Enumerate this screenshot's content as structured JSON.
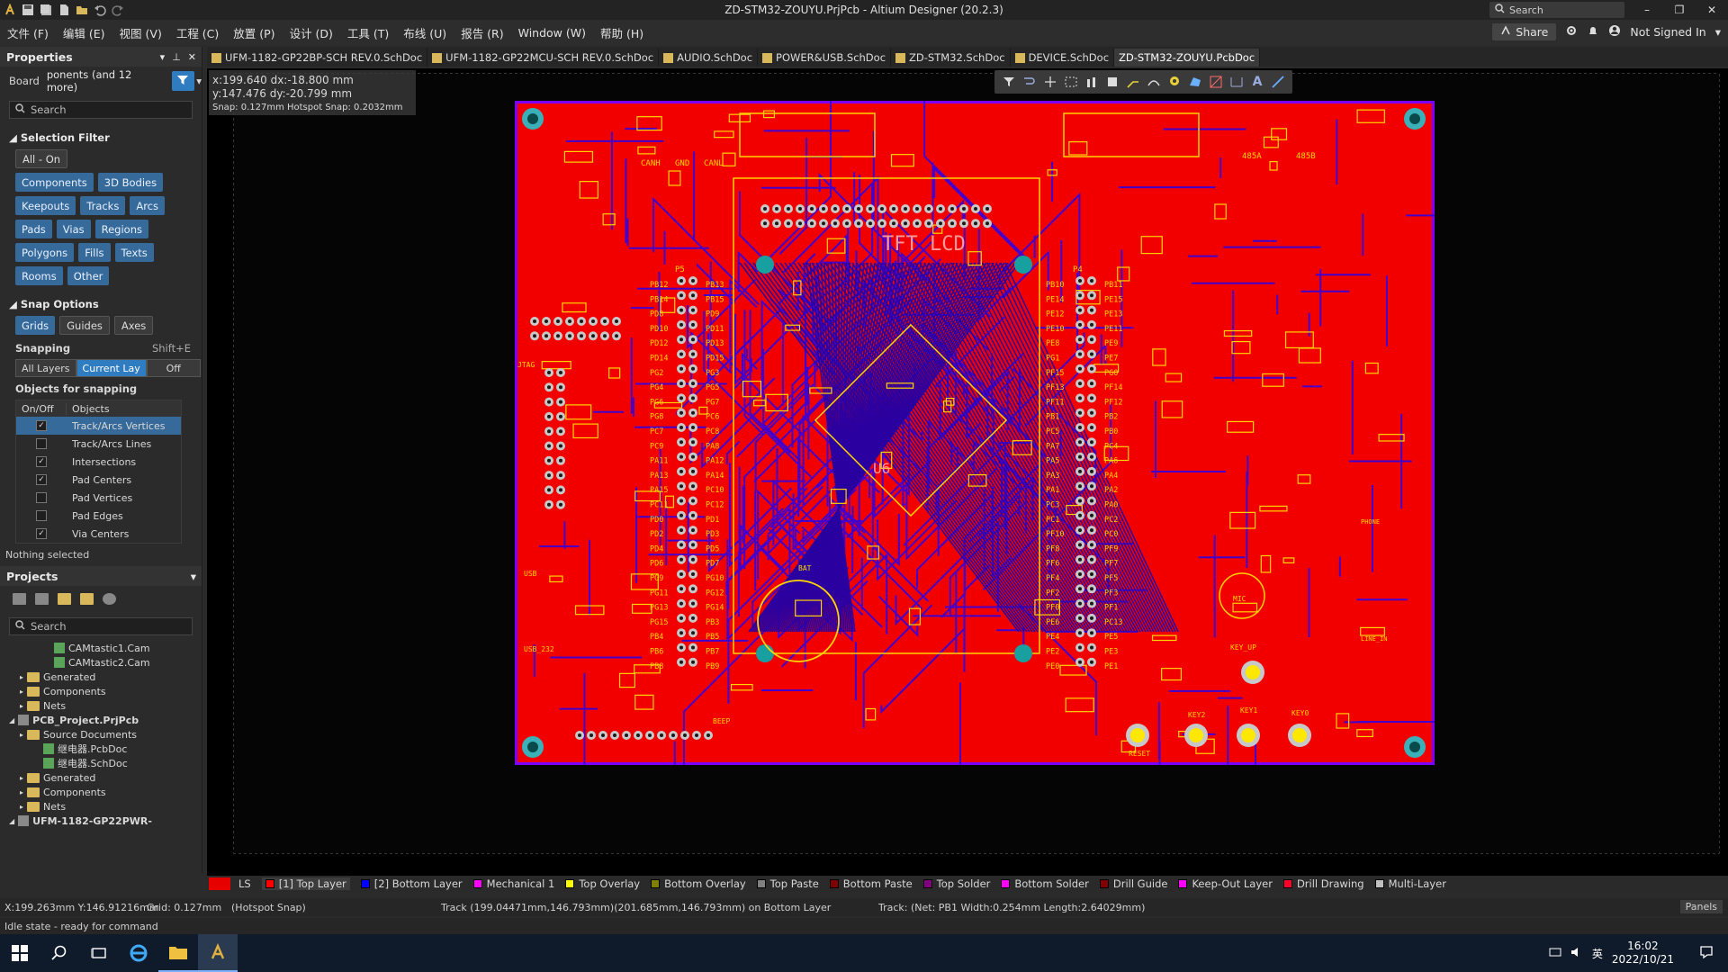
{
  "window": {
    "title": "ZD-STM32-ZOUYU.PrjPcb - Altium Designer (20.2.3)",
    "search_label": "Search",
    "controls": [
      "–",
      "❐",
      "✕"
    ]
  },
  "menu": {
    "items": [
      "文件 (F)",
      "编辑 (E)",
      "视图 (V)",
      "工程 (C)",
      "放置 (P)",
      "设计 (D)",
      "工具 (T)",
      "布线 (U)",
      "报告 (R)",
      "Window (W)",
      "帮助 (H)"
    ],
    "share_label": "Share",
    "user_label": "Not Signed In"
  },
  "properties": {
    "title": "Properties",
    "board_label": "Board",
    "board_value": "ponents (and 12 more)",
    "search_placeholder": "Search",
    "selection_filter_title": "Selection Filter",
    "all_on": "All - On",
    "filter_buttons": [
      "Components",
      "3D Bodies",
      "Keepouts",
      "Tracks",
      "Arcs",
      "Pads",
      "Vias",
      "Regions",
      "Polygons",
      "Fills",
      "Texts",
      "Rooms",
      "Other"
    ],
    "snap_options_title": "Snap Options",
    "snap_buttons": [
      "Grids",
      "Guides",
      "Axes"
    ],
    "snapping_label": "Snapping",
    "snapping_shortcut": "Shift+E",
    "snap_modes": [
      "All Layers",
      "Current Lay",
      "Off"
    ],
    "objects_title": "Objects for snapping",
    "table_headers": [
      "On/Off",
      "Objects"
    ],
    "objects": [
      {
        "name": "Track/Arcs Vertices",
        "checked": true,
        "selected": true
      },
      {
        "name": "Track/Arcs Lines",
        "checked": false,
        "selected": false
      },
      {
        "name": "Intersections",
        "checked": true,
        "selected": false
      },
      {
        "name": "Pad Centers",
        "checked": true,
        "selected": false
      },
      {
        "name": "Pad Vertices",
        "checked": false,
        "selected": false
      },
      {
        "name": "Pad Edges",
        "checked": false,
        "selected": false
      },
      {
        "name": "Via Centers",
        "checked": true,
        "selected": false
      }
    ],
    "nothing_selected": "Nothing selected"
  },
  "projects": {
    "title": "Projects",
    "search_placeholder": "Search",
    "tree": [
      {
        "label": "CAMtastic1.Cam",
        "indent": 3,
        "type": "file"
      },
      {
        "label": "CAMtastic2.Cam",
        "indent": 3,
        "type": "file"
      },
      {
        "label": "Generated",
        "indent": 1,
        "type": "folder"
      },
      {
        "label": "Components",
        "indent": 1,
        "type": "folder"
      },
      {
        "label": "Nets",
        "indent": 1,
        "type": "folder"
      },
      {
        "label": "PCB_Project.PrjPcb",
        "indent": 0,
        "type": "project"
      },
      {
        "label": "Source Documents",
        "indent": 1,
        "type": "folder"
      },
      {
        "label": "继电器.PcbDoc",
        "indent": 2,
        "type": "file"
      },
      {
        "label": "继电器.SchDoc",
        "indent": 2,
        "type": "file"
      },
      {
        "label": "Generated",
        "indent": 1,
        "type": "folder"
      },
      {
        "label": "Components",
        "indent": 1,
        "type": "folder"
      },
      {
        "label": "Nets",
        "indent": 1,
        "type": "folder"
      },
      {
        "label": "UFM-1182-GP22PWR-",
        "indent": 0,
        "type": "project"
      }
    ]
  },
  "doc_tabs": [
    {
      "label": "UFM-1182-GP22BP-SCH REV.0.SchDoc",
      "active": false,
      "kind": "sch"
    },
    {
      "label": "UFM-1182-GP22MCU-SCH REV.0.SchDoc",
      "active": false,
      "kind": "sch"
    },
    {
      "label": "AUDIO.SchDoc",
      "active": false,
      "kind": "sch"
    },
    {
      "label": "POWER&USB.SchDoc",
      "active": false,
      "kind": "sch"
    },
    {
      "label": "ZD-STM32.SchDoc",
      "active": false,
      "kind": "sch"
    },
    {
      "label": "DEVICE.SchDoc",
      "active": false,
      "kind": "sch"
    },
    {
      "label": "ZD-STM32-ZOUYU.PcbDoc",
      "active": true,
      "kind": "pcb"
    }
  ],
  "hud": {
    "line1": "x:199.640   dx:-18.800 mm",
    "line2": "y:147.476   dy:-20.799 mm",
    "line3": "Snap: 0.127mm Hotspot Snap: 0.2032mm"
  },
  "pcb_labels": {
    "tft": "TFT LCD",
    "u6": "U6",
    "p5": "P5",
    "p4": "P4",
    "jtag": "JTAG",
    "usb": "USB",
    "bat": "BAT",
    "mic": "MIC",
    "reset": "RESET",
    "key_up": "KEY_UP",
    "key2": "KEY2",
    "key1": "KEY1",
    "key0": "KEY0",
    "beep": "BEEP",
    "canh": "CANH",
    "gnd": "GND",
    "canl": "CANL",
    "r485a": "485A",
    "r485b": "485B",
    "usb232": "USB_232",
    "phone": "PHONE",
    "line_in": "LINE_IN",
    "left_pins": [
      "PB12",
      "PB14",
      "PD8",
      "PD10",
      "PD12",
      "PD14",
      "PG2",
      "PG4",
      "PG6",
      "PG8",
      "PC7",
      "PC9",
      "PA11",
      "PA13",
      "PA15",
      "PC11",
      "PD0",
      "PD2",
      "PD4",
      "PD6",
      "PG9",
      "PG11",
      "PG13",
      "PG15",
      "PB4",
      "PB6",
      "PB8"
    ],
    "left_pins2": [
      "PB13",
      "PB15",
      "PD9",
      "PD11",
      "PD13",
      "PD15",
      "PG3",
      "PG5",
      "PG7",
      "PC6",
      "PC8",
      "PA8",
      "PA12",
      "PA14",
      "PC10",
      "PC12",
      "PD1",
      "PD3",
      "PD5",
      "PD7",
      "PG10",
      "PG12",
      "PG14",
      "PB3",
      "PB5",
      "PB7",
      "PB9"
    ],
    "right_pins": [
      "PB10",
      "PE14",
      "PE12",
      "PE10",
      "PE8",
      "PG1",
      "PF15",
      "PF13",
      "PF11",
      "PB1",
      "PC5",
      "PA7",
      "PA5",
      "PA3",
      "PA1",
      "PC3",
      "PC1",
      "PF10",
      "PF8",
      "PF6",
      "PF4",
      "PF2",
      "PF0",
      "PE6",
      "PE4",
      "PE2",
      "PE0"
    ],
    "right_pins2": [
      "PB11",
      "PE15",
      "PE13",
      "PE11",
      "PE9",
      "PE7",
      "PG0",
      "PF14",
      "PF12",
      "PB2",
      "PB0",
      "PC4",
      "PA6",
      "PA4",
      "PA2",
      "PA0",
      "PC2",
      "PC0",
      "PF9",
      "PF7",
      "PF5",
      "PF3",
      "PF1",
      "PC13",
      "PE5",
      "PE3",
      "PE1"
    ]
  },
  "layers": {
    "ls": "LS",
    "items": [
      {
        "label": "[1] Top Layer",
        "color": "#ff0000",
        "active": true
      },
      {
        "label": "[2] Bottom Layer",
        "color": "#0000ff",
        "active": false
      },
      {
        "label": "Mechanical 1",
        "color": "#ff00ff",
        "active": false
      },
      {
        "label": "Top Overlay",
        "color": "#ffff00",
        "active": false
      },
      {
        "label": "Bottom Overlay",
        "color": "#808000",
        "active": false
      },
      {
        "label": "Top Paste",
        "color": "#808080",
        "active": false
      },
      {
        "label": "Bottom Paste",
        "color": "#800000",
        "active": false
      },
      {
        "label": "Top Solder",
        "color": "#800080",
        "active": false
      },
      {
        "label": "Bottom Solder",
        "color": "#ff00ff",
        "active": false
      },
      {
        "label": "Drill Guide",
        "color": "#800000",
        "active": false
      },
      {
        "label": "Keep-Out Layer",
        "color": "#ff00ff",
        "active": false
      },
      {
        "label": "Drill Drawing",
        "color": "#ff002a",
        "active": false
      },
      {
        "label": "Multi-Layer",
        "color": "#c0c0c0",
        "active": false
      }
    ]
  },
  "status": {
    "coords": "X:199.263mm Y:146.91216mm",
    "grid": "Grid: 0.127mm",
    "hotspot": "(Hotspot Snap)",
    "track_info": "Track (199.04471mm,146.793mm)(201.685mm,146.793mm) on Bottom Layer",
    "net_info": "Track: (Net: PB1 Width:0.254mm Length:2.64029mm)",
    "idle": "Idle state - ready for command",
    "panels": "Panels"
  },
  "taskbar": {
    "ime": "英",
    "time": "16:02",
    "date": "2022/10/21"
  }
}
